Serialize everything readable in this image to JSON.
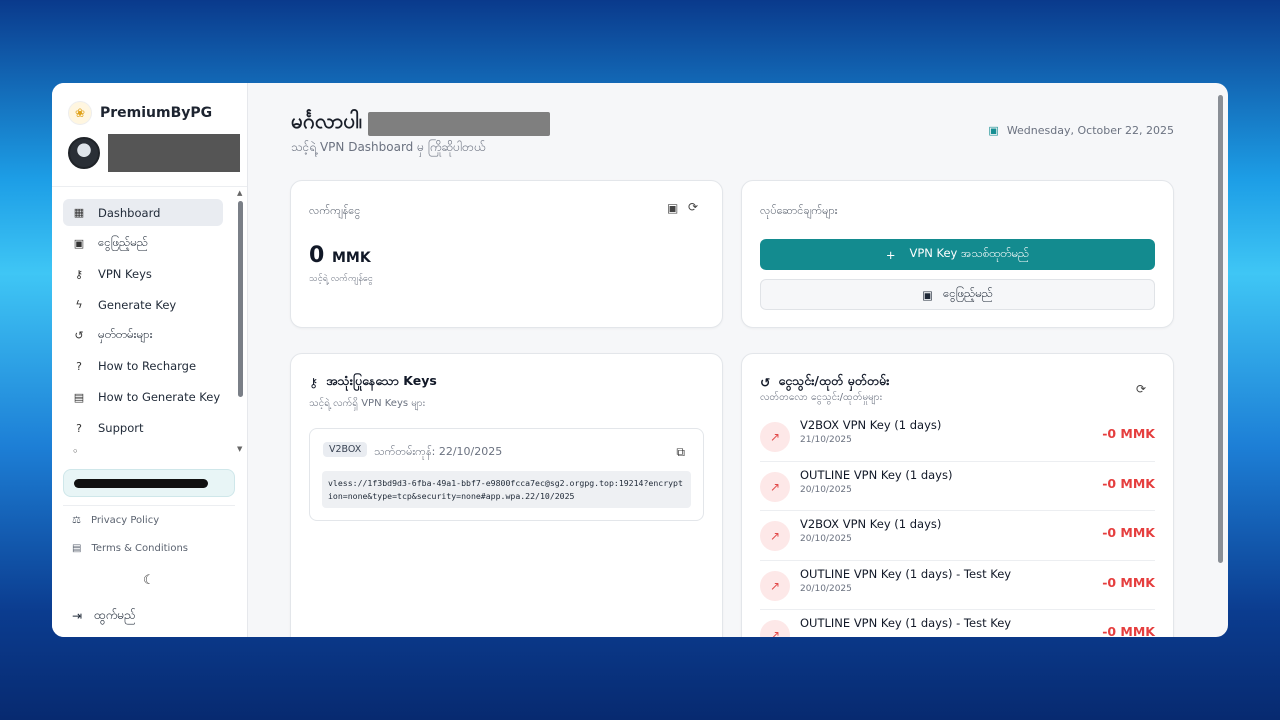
{
  "brand": {
    "name": "PremiumByPG",
    "logo_icon": "lotus-icon"
  },
  "sidebar": {
    "items": [
      {
        "label": "Dashboard",
        "icon": "grid-icon",
        "active": true
      },
      {
        "label": "ငွေဖြည့်မည်",
        "icon": "wallet-icon"
      },
      {
        "label": "VPN Keys",
        "icon": "key-icon"
      },
      {
        "label": "Generate Key",
        "icon": "bolt-icon"
      },
      {
        "label": "မှတ်တမ်းများ",
        "icon": "history-icon"
      },
      {
        "label": "How to Recharge",
        "icon": "help-icon"
      },
      {
        "label": "How to Generate Key",
        "icon": "document-icon"
      },
      {
        "label": "Support",
        "icon": "help-icon"
      }
    ],
    "privacy": "Privacy Policy",
    "terms": "Terms & Conditions",
    "logout": "ထွက်မည်"
  },
  "header": {
    "greeting": "မင်္ဂလာပါ၊",
    "subtitle": "သင့်ရဲ့ VPN Dashboard မှ ကြိုဆိုပါတယ်",
    "date": "Wednesday, October 22, 2025"
  },
  "balance_card": {
    "label": "လက်ကျန်ငွေ",
    "amount": "0",
    "currency": "MMK",
    "sub": "သင့်ရဲ့ လက်ကျန်ငွေ"
  },
  "actions_card": {
    "label": "လုပ်ဆောင်ချက်များ",
    "primary": "VPN Key အသစ်ထုတ်မည်",
    "secondary": "ငွေဖြည့်မည်"
  },
  "keys_card": {
    "title": "အသုံးပြုနေသော Keys",
    "sub": "သင့်ရဲ့ လက်ရှိ VPN Keys များ",
    "key": {
      "badge": "V2BOX",
      "expiry": "သက်တမ်းကုန်: 22/10/2025",
      "code": "vless://1f3bd9d3-6fba-49a1-bbf7-e9800fcca7ec@sg2.orgpg.top:19214?encryption=none&type=tcp&security=none#app.wpa.22/10/2025"
    }
  },
  "tx_card": {
    "title": "ငွေသွင်း/ထုတ် မှတ်တမ်း",
    "sub": "လတ်တလော ငွေသွင်း/ထုတ်မှုများ",
    "items": [
      {
        "title": "V2BOX VPN Key (1 days)",
        "date": "21/10/2025",
        "amount": "-0 MMK"
      },
      {
        "title": "OUTLINE VPN Key (1 days)",
        "date": "20/10/2025",
        "amount": "-0 MMK"
      },
      {
        "title": "V2BOX VPN Key (1 days)",
        "date": "20/10/2025",
        "amount": "-0 MMK"
      },
      {
        "title": "OUTLINE VPN Key (1 days) - Test Key",
        "date": "20/10/2025",
        "amount": "-0 MMK"
      },
      {
        "title": "OUTLINE VPN Key (1 days) - Test Key",
        "date": "",
        "amount": "-0 MMK"
      }
    ]
  },
  "colors": {
    "accent": "#138b8f",
    "negative": "#e53e3e"
  }
}
